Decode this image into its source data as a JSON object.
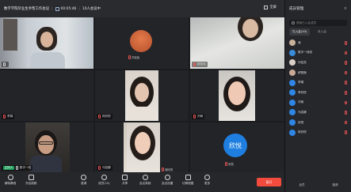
{
  "topbar": {
    "meeting_title": "数字学院毕业生手帮工作会议",
    "duration": "00:05:46",
    "participants_online": "10人会议中",
    "network_label": "",
    "record_label": "",
    "fullscreen_label": "全屏"
  },
  "tiles": [
    {
      "name": "",
      "muted": false
    },
    {
      "name": "刘佳怡",
      "muted": true
    },
    {
      "name": "郝佳佳",
      "muted": true
    },
    {
      "name": "李娟",
      "muted": true
    },
    {
      "name": "林欣悦",
      "muted": true
    },
    {
      "name": "刘雨",
      "muted": true
    },
    {
      "name": "数字一线",
      "muted": false,
      "speaking_badge": "主持人"
    },
    {
      "name": "马若娜",
      "muted": true
    },
    {
      "name": "胡欣悦",
      "muted": true
    },
    {
      "name": "欣悦",
      "muted": true,
      "avatar_text": "欣悦"
    }
  ],
  "sidebar": {
    "title": "成员管理",
    "search_placeholder": "搜索已入会成员",
    "tabs": [
      {
        "label": "已入会(10)"
      },
      {
        "label": "未入会"
      }
    ],
    "members": [
      {
        "name": "我",
        "color": "#c9b29a"
      },
      {
        "name": "数字一线线",
        "color": "#3a8bd8"
      },
      {
        "name": "刘佳凯",
        "color": "#d9d0c7"
      },
      {
        "name": "郝楚茜",
        "color": "#c8a995"
      },
      {
        "name": "李娟",
        "color": "#2f86e5"
      },
      {
        "name": "李欣悦",
        "color": "#2f86e5"
      },
      {
        "name": "刘雨",
        "color": "#2f86e5"
      },
      {
        "name": "马若娜",
        "color": "#2f86e5"
      },
      {
        "name": "欣悦",
        "color": "#2f86e5"
      },
      {
        "name": "林欣悦",
        "color": "#2f86e5"
      }
    ],
    "footer": {
      "mute_all": "全员",
      "more": "邀请"
    }
  },
  "toolbar": {
    "buttons": [
      {
        "label": "解除静音"
      },
      {
        "label": "开启视频"
      },
      {
        "label": "邀请"
      },
      {
        "label": "成员(10)"
      },
      {
        "label": "共享"
      },
      {
        "label": "会议录制"
      },
      {
        "label": "会议设置"
      },
      {
        "label": "切换视图"
      },
      {
        "label": "更多"
      }
    ],
    "end_label": "离开"
  }
}
